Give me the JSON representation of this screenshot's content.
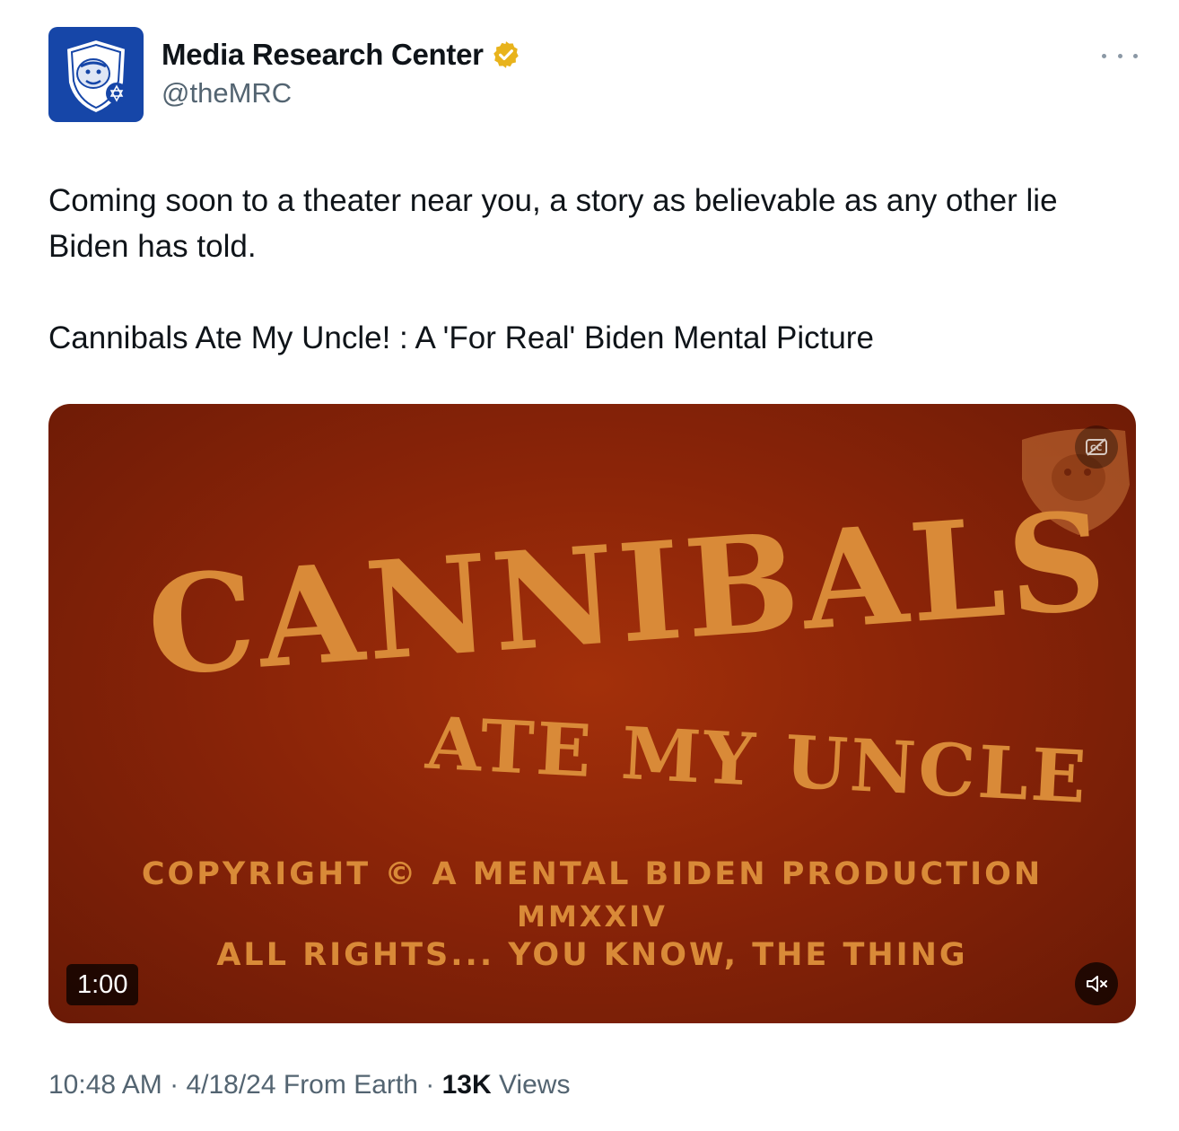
{
  "author": {
    "display_name": "Media Research Center",
    "handle": "@theMRC",
    "verified": true,
    "avatar_icon": "bulldog-shield-logo",
    "brand_color": "#1646a8",
    "verified_color": "#e8b31c"
  },
  "more_icon": "more-horizontal-icon",
  "tweet": {
    "text_line1": "Coming soon to a theater near you, a story as believable as any other lie\nBiden has told.",
    "text_line2": "Cannibals Ate My Uncle! : A 'For Real' Biden Mental Picture"
  },
  "media": {
    "type": "video",
    "title_big": "CANNIBALS",
    "title_small": "ATE MY UNCLE",
    "credit_line1": "COPYRIGHT © A MENTAL BIDEN PRODUCTION",
    "credit_line2": "MMXXIV",
    "credit_line3": "ALL RIGHTS... YOU KNOW, THE THING",
    "duration": "1:00",
    "mute_icon": "volume-muted-icon",
    "cc_icon": "captions-off-icon",
    "watermark_icon": "bulldog-shield-watermark",
    "background_color": "#8a2408",
    "text_color": "#d98a38"
  },
  "footer": {
    "time": "10:48 AM",
    "separator1": " · ",
    "date": "4/18/24",
    "location": " From Earth",
    "separator2": " · ",
    "views_count": "13K",
    "views_label": " Views"
  }
}
